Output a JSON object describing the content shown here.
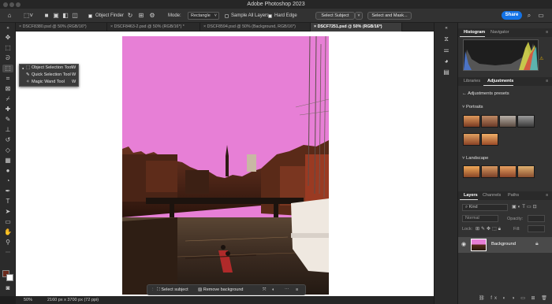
{
  "window": {
    "title": "Adobe Photoshop 2023"
  },
  "options_bar": {
    "object_finder_label": "Object Finder",
    "mode_label": "Mode:",
    "mode_value": "Rectangle",
    "sample_all_layers_label": "Sample All Layers",
    "sample_all_layers_checked": false,
    "hard_edge_label": "Hard Edge",
    "hard_edge_checked": true,
    "select_subject_label": "Select Subject",
    "select_and_mask_label": "Select and Mask...",
    "share_label": "Share"
  },
  "doc_tabs": [
    {
      "label": "DSCF8380.psd @ 50% (RGB/16*)",
      "active": false
    },
    {
      "label": "DSCF8463-2.psd @ 50% (RGB/16*) *",
      "active": false
    },
    {
      "label": "DSCF8594.psd @ 50% (Background, RGB/16*)",
      "active": false
    },
    {
      "label": "DSCF7251.psd @ 50% (RGB/16*)",
      "active": true
    }
  ],
  "tool_flyout": {
    "items": [
      {
        "label": "Object Selection Tool",
        "shortcut": "W",
        "selected": true
      },
      {
        "label": "Quick Selection Tool",
        "shortcut": "W",
        "selected": false
      },
      {
        "label": "Magic Wand Tool",
        "shortcut": "W",
        "selected": false
      }
    ]
  },
  "context_bar": {
    "select_subject_label": "Select subject",
    "remove_background_label": "Remove background"
  },
  "status_bar": {
    "zoom": "50%",
    "doc_info": "2160 px x 3700 px (72 ppi)"
  },
  "histogram_panel": {
    "tabs": [
      "Histogram",
      "Navigator"
    ],
    "active_tab": "Histogram"
  },
  "adjustments_panel": {
    "tabs": [
      "Libraries",
      "Adjustments"
    ],
    "active_tab": "Adjustments",
    "presets_label": "Adjustments presets",
    "sections": [
      {
        "label": "Portraits",
        "thumb_count": 6
      },
      {
        "label": "Landscape",
        "thumb_count": 4
      }
    ]
  },
  "layers_panel": {
    "tabs": [
      "Layers",
      "Channels",
      "Paths"
    ],
    "active_tab": "Layers",
    "filter_placeholder": "Kind",
    "blend_mode": "Normal",
    "opacity_label": "Opacity:",
    "lock_label": "Lock:",
    "fill_label": "Fill:",
    "layers": [
      {
        "name": "Background",
        "visible": true,
        "locked": true
      }
    ]
  },
  "colors": {
    "accent": "#1473e6",
    "canvas_bg": "#ffffff",
    "sky_overlay": "#e77fd6",
    "panel_bg": "#323232",
    "toolbar_bg": "#2b2b2b"
  },
  "icons": [
    "home-icon",
    "object-selection-icon",
    "refresh-icon",
    "gear-icon",
    "move-icon",
    "marquee-icon",
    "lasso-icon",
    "crop-icon",
    "eyedropper-icon",
    "healing-brush-icon",
    "brush-icon",
    "clone-stamp-icon",
    "eraser-icon",
    "gradient-icon",
    "dodge-icon",
    "pen-icon",
    "type-icon",
    "path-selection-icon",
    "shape-icon",
    "hand-icon",
    "zoom-icon",
    "eye-icon",
    "lock-icon"
  ]
}
